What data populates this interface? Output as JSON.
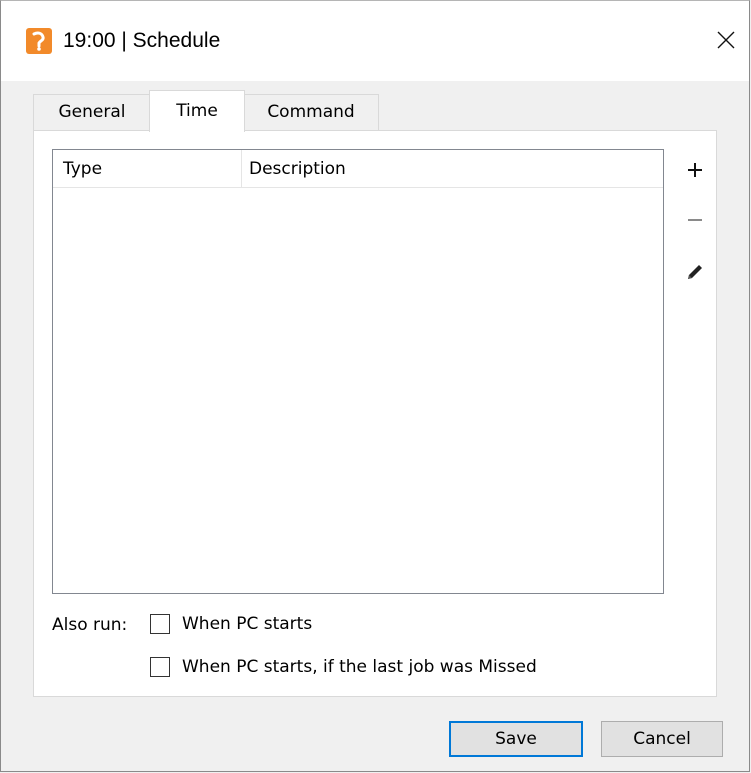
{
  "window": {
    "title": "19:00 | Schedule",
    "icon": "app-icon",
    "close_icon": "close-icon"
  },
  "tabs": [
    {
      "label": "General",
      "active": false
    },
    {
      "label": "Time",
      "active": true
    },
    {
      "label": "Command",
      "active": false
    }
  ],
  "list": {
    "columns": [
      "Type",
      "Description"
    ],
    "rows": []
  },
  "side_buttons": {
    "add_icon": "plus-icon",
    "remove_icon": "minus-icon",
    "edit_icon": "pencil-icon"
  },
  "also_run": {
    "label": "Also run:",
    "options": [
      {
        "label": "When PC starts",
        "checked": false
      },
      {
        "label": "When PC starts, if the last job was Missed",
        "checked": false
      }
    ]
  },
  "footer": {
    "save_label": "Save",
    "cancel_label": "Cancel"
  },
  "colors": {
    "accent": "#0078d7",
    "app_icon": "#f28a2a"
  }
}
